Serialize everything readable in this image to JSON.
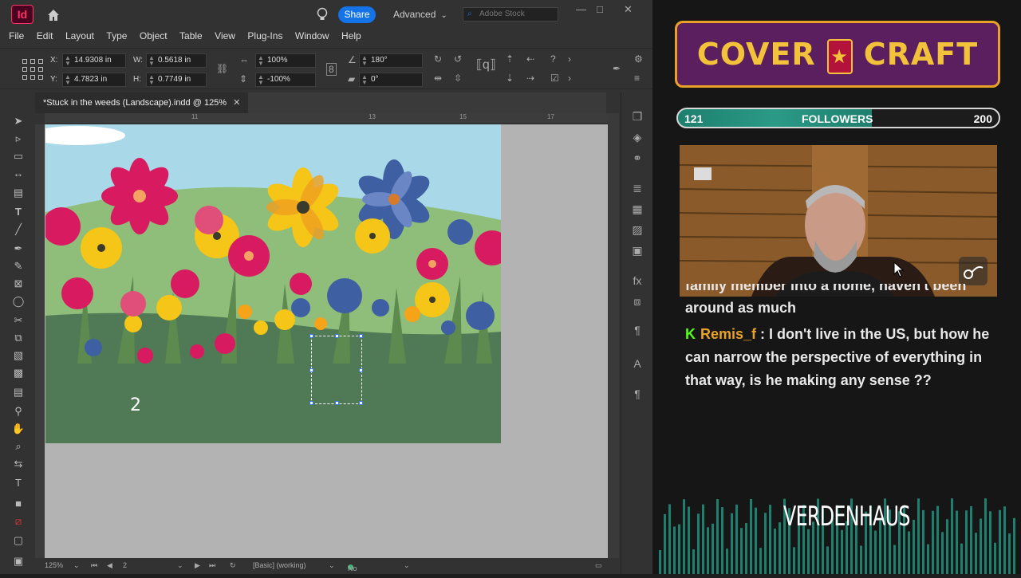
{
  "app": {
    "logo_label": "Id",
    "share_label": "Share",
    "workspace_label": "Advanced",
    "stock_placeholder": "Adobe Stock",
    "menu": [
      "File",
      "Edit",
      "Layout",
      "Type",
      "Object",
      "Table",
      "View",
      "Plug-Ins",
      "Window",
      "Help"
    ]
  },
  "control_panel": {
    "x_label": "X:",
    "x_value": "14.9308 in",
    "y_label": "Y:",
    "y_value": "4.7823 in",
    "w_label": "W:",
    "w_value": "0.5618 in",
    "h_label": "H:",
    "h_value": "0.7749 in",
    "scale_x": "100%",
    "scale_y": "-100%",
    "rotate": "180°",
    "shear": "0°"
  },
  "document": {
    "tab_title": "*Stuck in the weeds (Landscape).indd @ 125%",
    "ruler_ticks": [
      "11",
      "13",
      "15",
      "17"
    ],
    "page_number_text": "2"
  },
  "status": {
    "zoom": "125%",
    "page": "2",
    "style": "[Basic] (working)",
    "preflight": "No errors"
  },
  "overlay": {
    "logo_left": "COVER",
    "logo_right": "CRAFT",
    "followers_current": "121",
    "followers_label": "FOLLOWERS",
    "followers_goal": "200",
    "followers_progress": 0.605,
    "chat_prev_line1": "family member into a home, haven't been",
    "chat_prev_line2": "around as much",
    "chat_user": "Remis_f",
    "chat_sep": " : ",
    "chat_message": "I don't live in the US, but how he can narrow the perspective of everything in that way, is he making any sense ??",
    "brand_text": "VERDENHAUS",
    "colors": {
      "accent": "#e9a227",
      "purple": "#5b1f5f",
      "teal": "#1e7f6e",
      "kick": "#53fc18"
    }
  }
}
